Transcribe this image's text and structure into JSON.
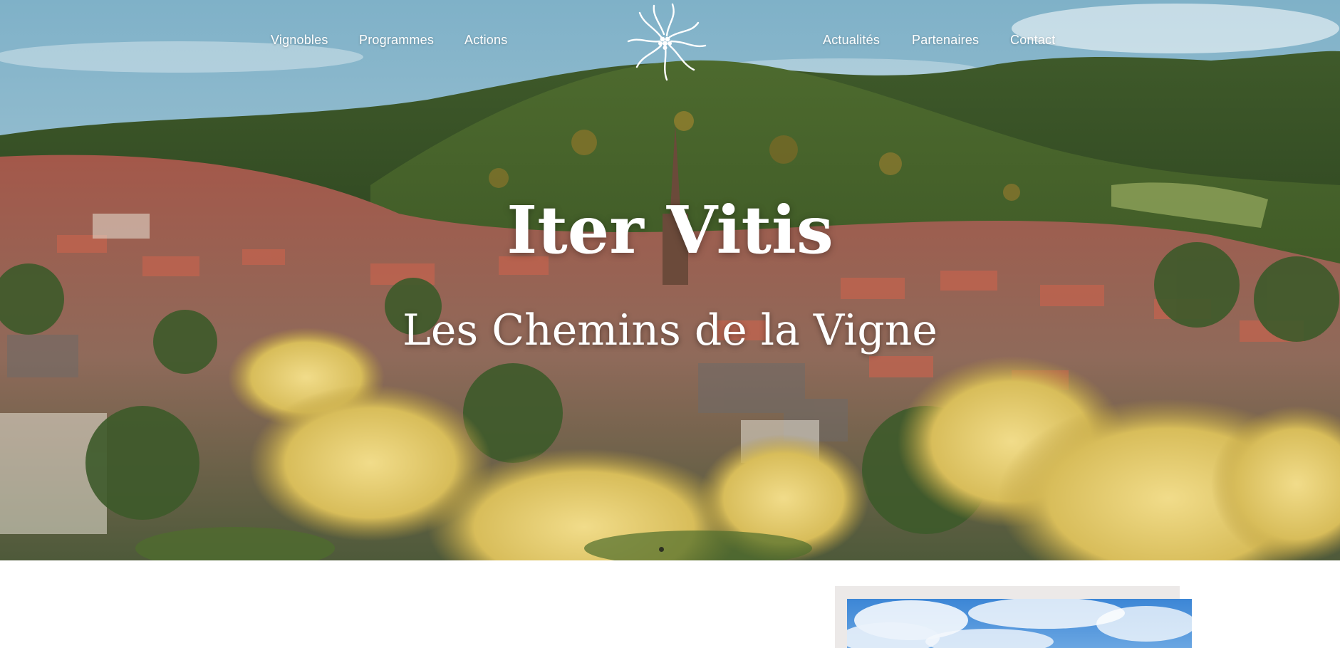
{
  "nav": {
    "left": [
      {
        "label": "Vignobles"
      },
      {
        "label": "Programmes"
      },
      {
        "label": "Actions"
      }
    ],
    "right": [
      {
        "label": "Actualités"
      },
      {
        "label": "Partenaires"
      },
      {
        "label": "Contact"
      }
    ]
  },
  "logo": {
    "icon": "sun-grape-logo-icon"
  },
  "hero": {
    "title": "Iter Vitis",
    "subtitle": "Les Chemins de la Vigne",
    "background": "photo of Alsatian village in a valley with forested hills and yellow ivy flowers in the foreground",
    "slide_indicator": {
      "current": 1
    }
  },
  "colors": {
    "nav_text": "#ffffff",
    "hero_text": "#ffffff",
    "card_frame": "#ece9e8",
    "page_bg": "#ffffff"
  }
}
